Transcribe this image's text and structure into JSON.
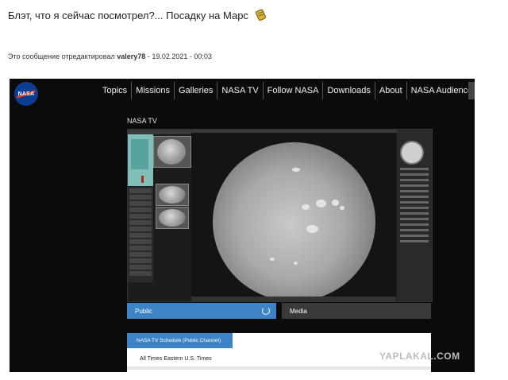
{
  "post": {
    "title": "Блэт, что я сейчас посмотрел?... Посадку на Марс",
    "edit_prefix": "Это сообщение отредактировал",
    "edit_user": "valery78",
    "edit_sep": "-",
    "edit_date": "19.02.2021 - 00:03"
  },
  "nasa": {
    "logo_text": "NASA",
    "nav": [
      "Topics",
      "Missions",
      "Galleries",
      "NASA TV",
      "Follow NASA",
      "Downloads",
      "About",
      "NASA Audiences"
    ],
    "section_title": "NASA TV",
    "tabs": {
      "public": "Public",
      "media": "Media"
    },
    "schedule": {
      "tab_label": "NASA TV Schedule (Public Channel)",
      "times_label": "All Times Eastern U.S. Times"
    }
  },
  "watermark": "YAPLAKAL.COM",
  "colors": {
    "nasa_blue": "#0b3d91",
    "nasa_red": "#fc3d21",
    "tab_blue": "#3c84c6",
    "page_black": "#0b0b0b"
  }
}
